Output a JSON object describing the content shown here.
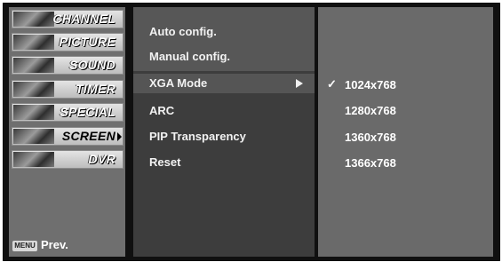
{
  "categories": [
    {
      "label": "CHANNEL"
    },
    {
      "label": "PICTURE"
    },
    {
      "label": "SOUND"
    },
    {
      "label": "TIMER"
    },
    {
      "label": "SPECIAL"
    },
    {
      "label": "SCREEN"
    },
    {
      "label": "DVR"
    }
  ],
  "active_category": "SCREEN",
  "footer": {
    "menu_key": "MENU",
    "prev_label": "Prev."
  },
  "submenu": {
    "items": [
      {
        "label": "Auto config."
      },
      {
        "label": "Manual config."
      },
      {
        "label": "XGA Mode"
      },
      {
        "label": "ARC"
      },
      {
        "label": "PIP Transparency"
      },
      {
        "label": "Reset"
      }
    ],
    "selected": "XGA Mode"
  },
  "options": {
    "items": [
      {
        "label": "1024x768"
      },
      {
        "label": "1280x768"
      },
      {
        "label": "1360x768"
      },
      {
        "label": "1366x768"
      }
    ],
    "checked": "1024x768",
    "check_glyph": "✓"
  }
}
